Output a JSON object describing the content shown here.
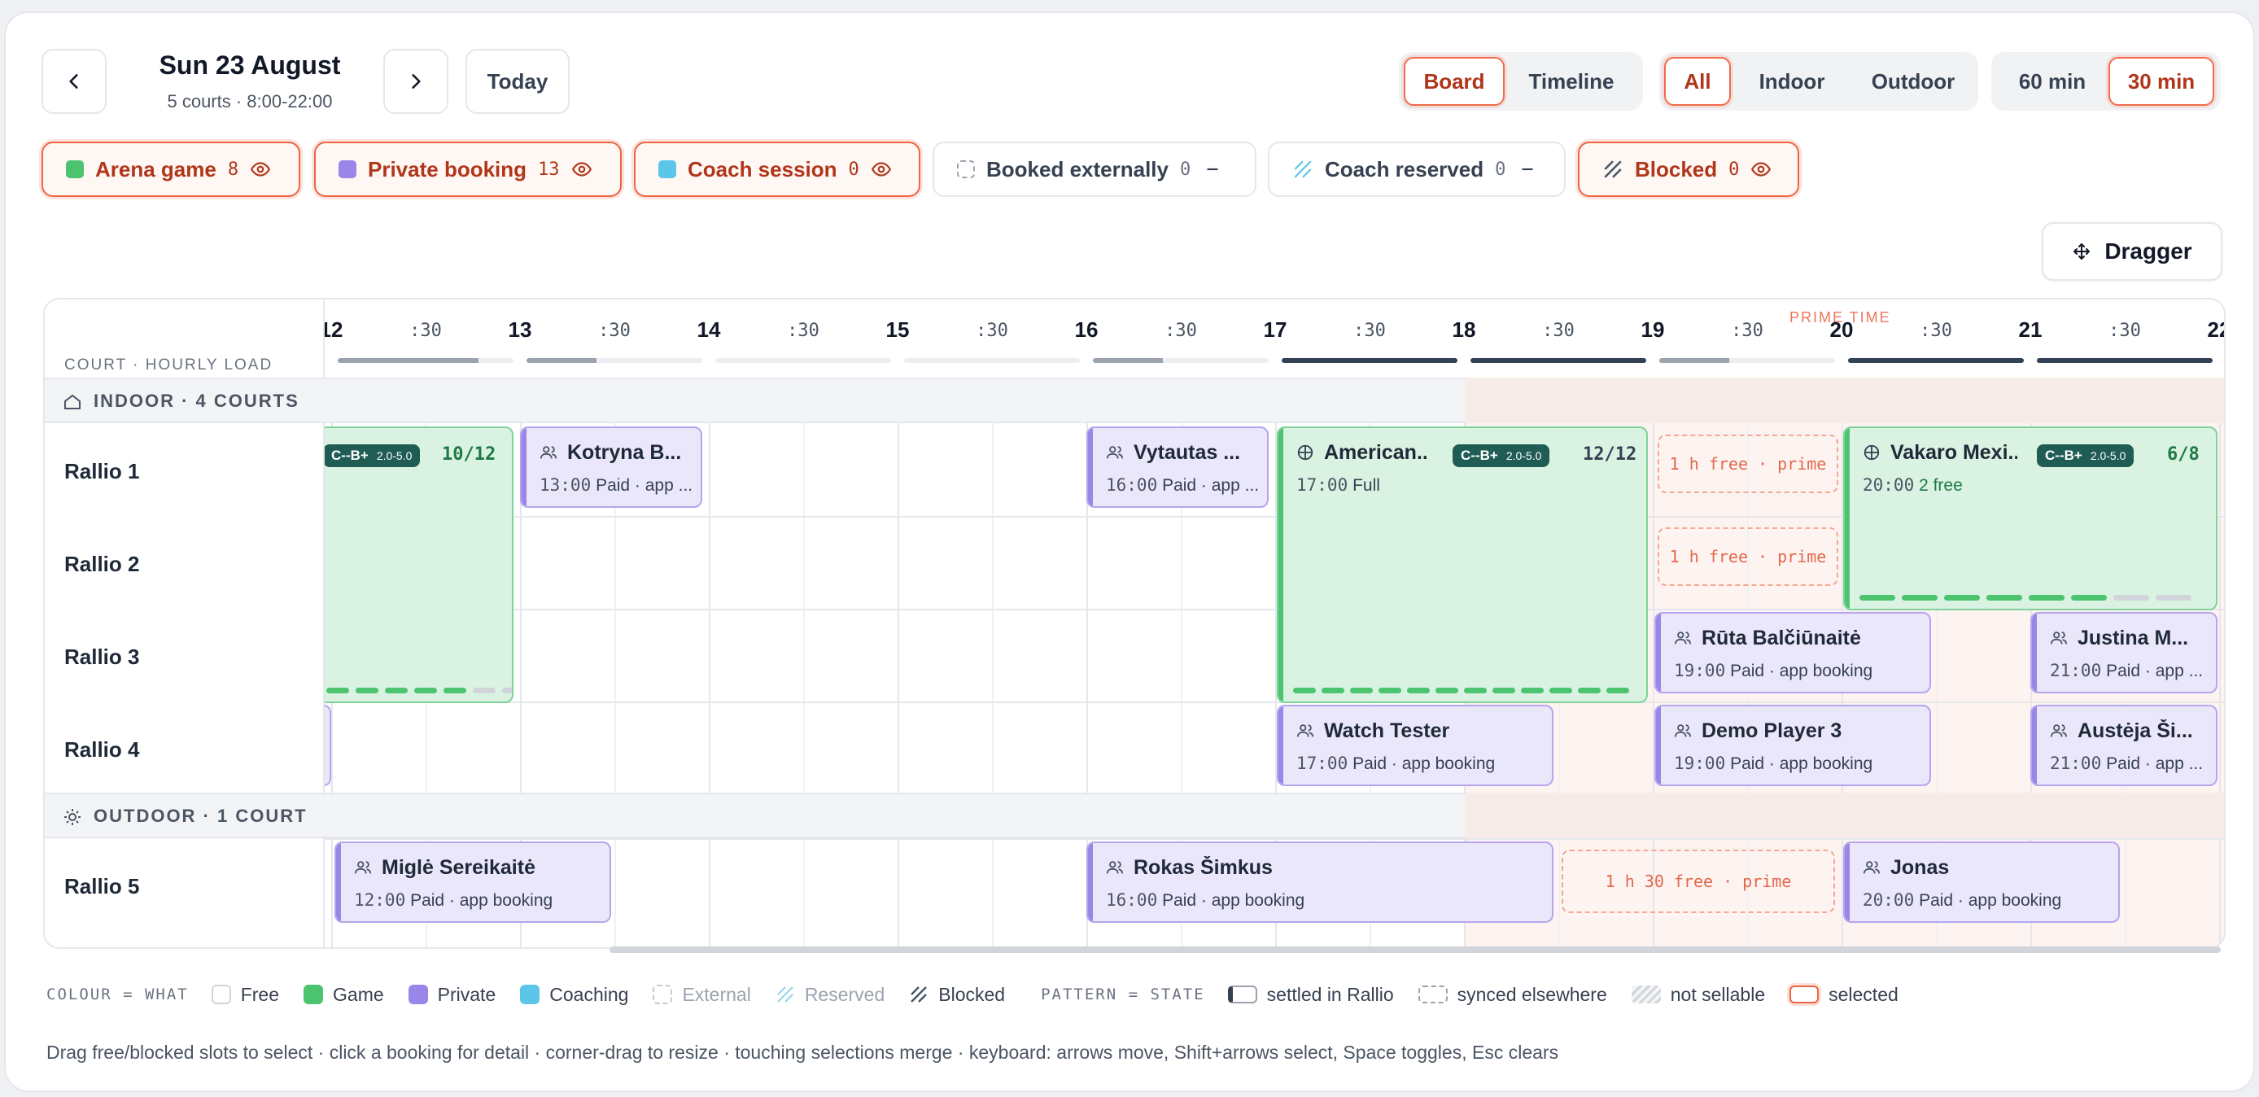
{
  "header": {
    "date_title": "Sun 23 August",
    "date_subtitle": "5 courts · 8:00-22:00",
    "today_label": "Today",
    "view_modes": [
      "Board",
      "Timeline"
    ],
    "selected_view": "Board",
    "environments": [
      "All",
      "Indoor",
      "Outdoor"
    ],
    "selected_environment": "All",
    "slot_sizes": [
      "60 min",
      "30 min"
    ],
    "selected_slot": "30 min",
    "dragger_label": "Dragger"
  },
  "filters": [
    {
      "label": "Arena game",
      "count": "8",
      "color": "#4cc46f",
      "state": "visible"
    },
    {
      "label": "Private booking",
      "count": "13",
      "color": "#9a85e8",
      "state": "visible"
    },
    {
      "label": "Coach session",
      "count": "0",
      "color": "#5bc6e8",
      "state": "visible"
    },
    {
      "label": "Booked externally",
      "count": "0",
      "state": "hidden"
    },
    {
      "label": "Coach reserved",
      "count": "0",
      "state": "hidden"
    },
    {
      "label": "Blocked",
      "count": "0",
      "state": "visible"
    }
  ],
  "grid": {
    "header_label": "COURT · HOURLY LOAD",
    "prime_label": "PRIME TIME",
    "hour_labels": [
      "12",
      "13",
      "14",
      "15",
      "16",
      "17",
      "18",
      "19",
      "20",
      "21",
      "22"
    ],
    "half_label": ":30",
    "hourly_load": [
      0.8,
      0.4,
      0,
      0,
      0.4,
      1,
      1,
      0.4,
      1,
      1
    ],
    "sections": [
      {
        "label": "INDOOR · 4 COURTS",
        "courts": [
          "Rallio 1",
          "Rallio 2",
          "Rallio 3",
          "Rallio 4"
        ]
      },
      {
        "label": "OUTDOOR · 1 COURT",
        "courts": [
          "Rallio 5"
        ]
      }
    ]
  },
  "bookings": {
    "arena_left": {
      "level": "C--B+",
      "range": "2.0-5.0",
      "capacity": "10/12"
    },
    "kotryna": {
      "name": "Kotryna B...",
      "time": "13:00",
      "status": "Paid · app ..."
    },
    "vytautas": {
      "name": "Vytautas ...",
      "time": "16:00",
      "status": "Paid · app ..."
    },
    "american": {
      "name": "American...",
      "level": "C--B+",
      "range": "2.0-5.0",
      "capacity": "12/12",
      "time": "17:00",
      "status": "Full"
    },
    "vakaro": {
      "name": "Vakaro Mexi...",
      "level": "C--B+",
      "range": "2.0-5.0",
      "capacity": "6/8",
      "time": "20:00",
      "status": "2 free"
    },
    "ruta": {
      "name": "Rūta Balčiūnaitė",
      "time": "19:00",
      "status": "Paid · app booking"
    },
    "justina": {
      "name": "Justina M...",
      "time": "21:00",
      "status": "Paid · app ..."
    },
    "watch": {
      "name": "Watch Tester",
      "time": "17:00",
      "status": "Paid · app booking"
    },
    "demo": {
      "name": "Demo Player 3",
      "time": "19:00",
      "status": "Paid · app booking"
    },
    "austeja": {
      "name": "Austėja Ši...",
      "time": "21:00",
      "status": "Paid · app ..."
    },
    "migle": {
      "name": "Miglė Sereikaitė",
      "time": "12:00",
      "status": "Paid · app booking"
    },
    "rokas": {
      "name": "Rokas Šimkus",
      "time": "16:00",
      "status": "Paid · app booking"
    },
    "jonas": {
      "name": "Jonas",
      "time": "20:00",
      "status": "Paid · app booking"
    }
  },
  "free_slots": {
    "r1": "1 h free · prime",
    "r2": "1 h free · prime",
    "r5": "1 h 30 free · prime"
  },
  "legend": {
    "colour_caption": "COLOUR = WHAT",
    "colour_items": [
      "Free",
      "Game",
      "Private",
      "Coaching",
      "External",
      "Reserved",
      "Blocked"
    ],
    "pattern_caption": "PATTERN = STATE",
    "pattern_items": [
      "settled in Rallio",
      "synced elsewhere",
      "not sellable",
      "selected"
    ]
  },
  "help_text": "Drag free/blocked slots to select · click a booking for detail · corner-drag to resize · touching selections merge · keyboard: arrows move, Shift+arrows select, Space toggles, Esc clears"
}
